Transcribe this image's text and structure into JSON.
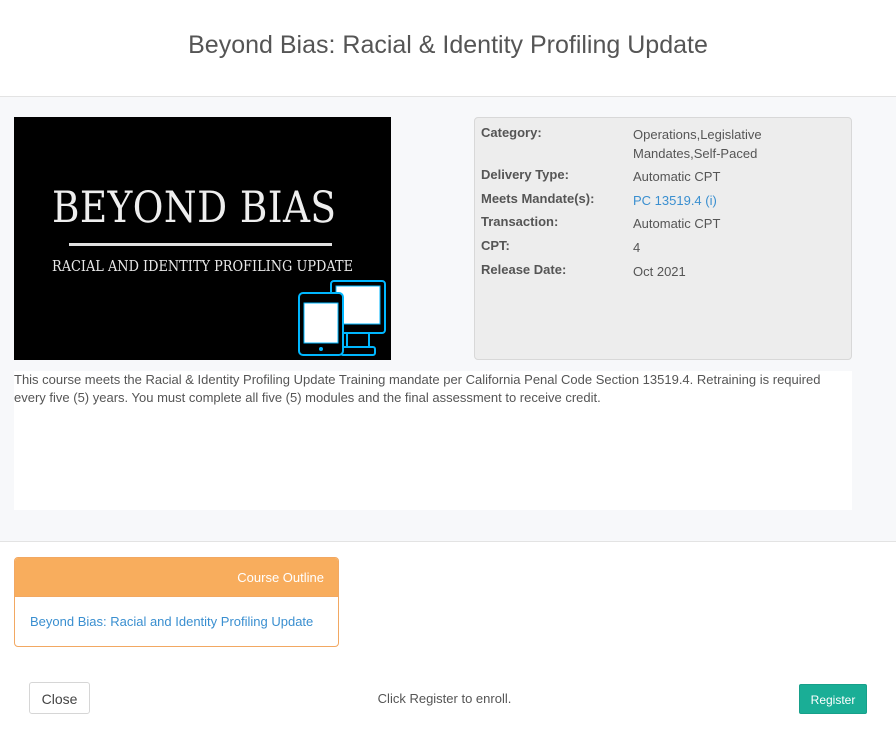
{
  "modal": {
    "title": "Beyond Bias: Racial & Identity Profiling Update"
  },
  "course_image": {
    "title_text": "BEYOND BIAS",
    "subtitle_text": "RACIAL AND IDENTITY PROFILING UPDATE",
    "icon": "devices-icon",
    "accent_color": "#00b7ff"
  },
  "details": {
    "category_label": "Category:",
    "category_value": "Operations,Legislative Mandates,Self-Paced",
    "delivery_label": "Delivery Type:",
    "delivery_value": "Automatic CPT",
    "mandate_label": "Meets Mandate(s):",
    "mandate_value": "PC 13519.4 (i)",
    "transaction_label": "Transaction:",
    "transaction_value": "Automatic CPT",
    "cpt_label": "CPT:",
    "cpt_value": "4",
    "release_label": "Release Date:",
    "release_value": "Oct 2021"
  },
  "description": "This course meets the Racial & Identity Profiling Update Training mandate per California Penal Code Section 13519.4. Retraining is required every five (5) years. You must complete all five (5) modules and the final assessment to receive credit.",
  "outline": {
    "heading": "Course Outline",
    "items": [
      "Beyond Bias: Racial and Identity Profiling Update"
    ]
  },
  "footer": {
    "close_label": "Close",
    "note": "Click Register to enroll.",
    "register_label": "Register"
  },
  "colors": {
    "register": "#1aae96",
    "outline_header": "#f8ad5d",
    "link": "#3a8fd0"
  }
}
